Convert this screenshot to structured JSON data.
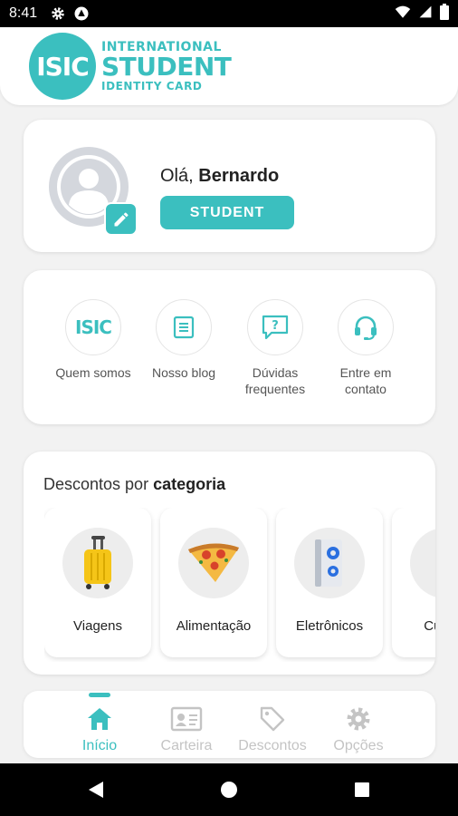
{
  "status_bar": {
    "time": "8:41"
  },
  "header": {
    "logo": {
      "mark": "ISIC",
      "line1": "INTERNATIONAL",
      "line2": "STUDENT",
      "line3": "IDENTITY CARD"
    }
  },
  "profile": {
    "greeting_prefix": "Olá,",
    "name": "Bernardo",
    "badge": "STUDENT"
  },
  "quick_links": [
    {
      "icon": "isic-logo-icon",
      "label": "Quem somos"
    },
    {
      "icon": "blog-document-icon",
      "label": "Nosso blog"
    },
    {
      "icon": "question-chat-icon",
      "label": "Dúvidas frequentes"
    },
    {
      "icon": "headset-icon",
      "label": "Entre em contato"
    }
  ],
  "quick_link_isic_text": "ISIC",
  "categories": {
    "title_prefix": "Descontos por",
    "title_bold": "categoria",
    "items": [
      {
        "icon": "suitcase-icon",
        "label": "Viagens"
      },
      {
        "icon": "pizza-icon",
        "label": "Alimentação"
      },
      {
        "icon": "speaker-icon",
        "label": "Eletrônicos"
      },
      {
        "icon": "course-icon",
        "label": "Cursos"
      }
    ]
  },
  "bottom_nav": [
    {
      "icon": "home-icon",
      "label": "Início",
      "active": true
    },
    {
      "icon": "id-card-icon",
      "label": "Carteira",
      "active": false
    },
    {
      "icon": "tag-icon",
      "label": "Descontos",
      "active": false
    },
    {
      "icon": "gear-icon",
      "label": "Opções",
      "active": false
    }
  ],
  "colors": {
    "accent": "#3bbfbf",
    "inactive": "#c4c4c4",
    "background": "#f2f2f2"
  }
}
